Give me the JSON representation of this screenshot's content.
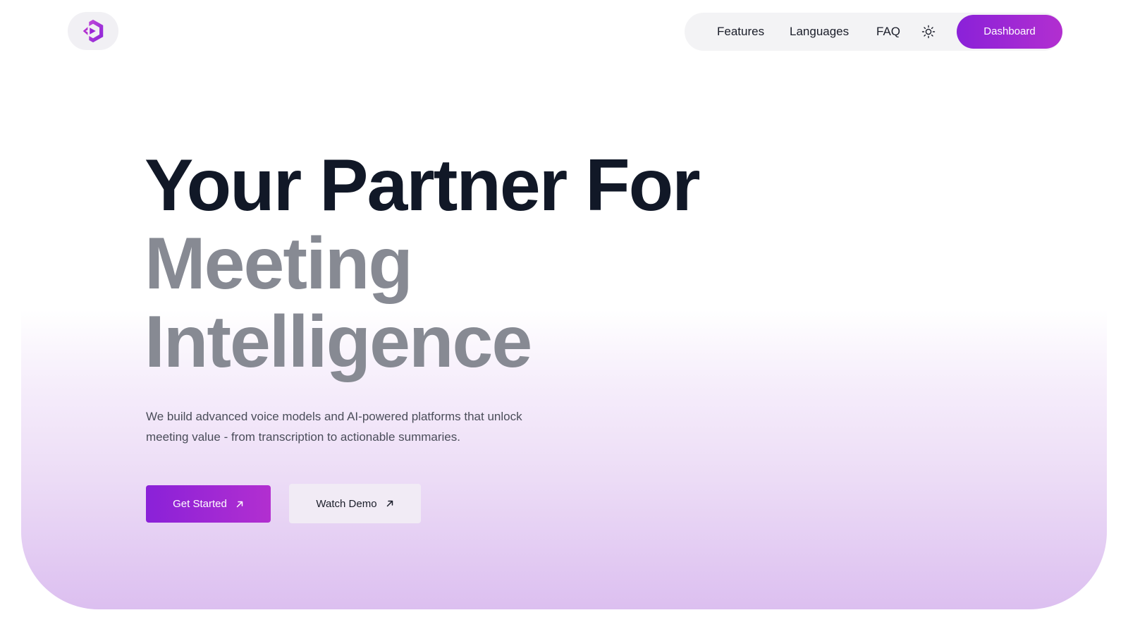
{
  "brand": {
    "logo_icon": "hexagon-code-logo-icon",
    "accent_start": "#8a21d8",
    "accent_end": "#b22fd0"
  },
  "nav": {
    "features_label": "Features",
    "languages_label": "Languages",
    "faq_label": "FAQ",
    "theme_icon": "sun-icon",
    "dashboard_label": "Dashboard"
  },
  "hero": {
    "headline_line1": "Your Partner For",
    "headline_line2": "Meeting",
    "headline_line3": "Intelligence",
    "subtitle_line1": "We build advanced voice models and AI-powered platforms that unlock",
    "subtitle_line2": "meeting value - from transcription to actionable summaries.",
    "primary_cta_label": "Get Started",
    "primary_cta_icon": "arrow-up-right-icon",
    "secondary_cta_label": "Watch Demo",
    "secondary_cta_icon": "arrow-up-right-icon"
  }
}
